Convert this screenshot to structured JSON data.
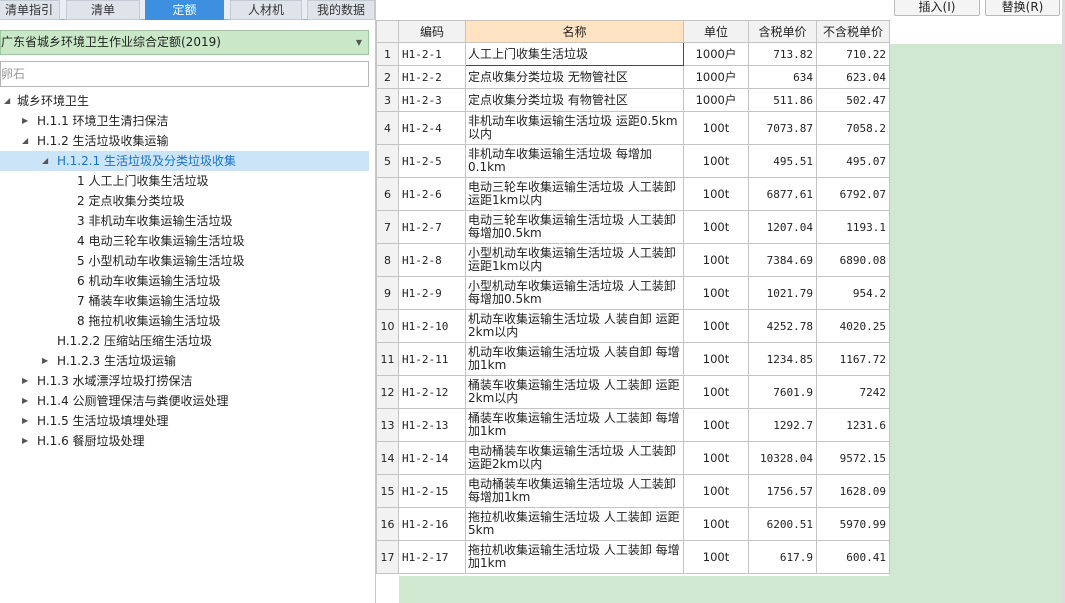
{
  "tabs": [
    {
      "label": "清单指引",
      "active": false
    },
    {
      "label": "清单",
      "active": false
    },
    {
      "label": "定额",
      "active": true
    },
    {
      "label": "人材机",
      "active": false
    },
    {
      "label": "我的数据",
      "active": false
    }
  ],
  "toolbar": {
    "insert_label": "插入(I)",
    "replace_label": "替换(R)"
  },
  "library_select": {
    "value": "广东省城乡环境卫生作业综合定额(2019)"
  },
  "search": {
    "value": "卵石"
  },
  "tree": [
    {
      "label": "城乡环境卫生",
      "level": 0,
      "toggle": "expanded",
      "selected": false
    },
    {
      "label": "H.1.1 环境卫生清扫保洁",
      "level": 1,
      "toggle": "collapsed",
      "selected": false
    },
    {
      "label": "H.1.2 生活垃圾收集运输",
      "level": 1,
      "toggle": "expanded",
      "selected": false
    },
    {
      "label": "H.1.2.1 生活垃圾及分类垃圾收集",
      "level": 2,
      "toggle": "expanded",
      "selected": true
    },
    {
      "label": "1 人工上门收集生活垃圾",
      "level": 3,
      "toggle": "none",
      "selected": false
    },
    {
      "label": "2 定点收集分类垃圾",
      "level": 3,
      "toggle": "none",
      "selected": false
    },
    {
      "label": "3 非机动车收集运输生活垃圾",
      "level": 3,
      "toggle": "none",
      "selected": false
    },
    {
      "label": "4 电动三轮车收集运输生活垃圾",
      "level": 3,
      "toggle": "none",
      "selected": false
    },
    {
      "label": "5 小型机动车收集运输生活垃圾",
      "level": 3,
      "toggle": "none",
      "selected": false
    },
    {
      "label": "6 机动车收集运输生活垃圾",
      "level": 3,
      "toggle": "none",
      "selected": false
    },
    {
      "label": "7 桶装车收集运输生活垃圾",
      "level": 3,
      "toggle": "none",
      "selected": false
    },
    {
      "label": "8 拖拉机收集运输生活垃圾",
      "level": 3,
      "toggle": "none",
      "selected": false
    },
    {
      "label": "H.1.2.2 压缩站压缩生活垃圾",
      "level": 2,
      "toggle": "none",
      "selected": false
    },
    {
      "label": "H.1.2.3 生活垃圾运输",
      "level": 2,
      "toggle": "collapsed",
      "selected": false
    },
    {
      "label": "H.1.3 水域漂浮垃圾打捞保洁",
      "level": 1,
      "toggle": "collapsed",
      "selected": false
    },
    {
      "label": "H.1.4 公厕管理保洁与粪便收运处理",
      "level": 1,
      "toggle": "collapsed",
      "selected": false
    },
    {
      "label": "H.1.5 生活垃圾填埋处理",
      "level": 1,
      "toggle": "collapsed",
      "selected": false
    },
    {
      "label": "H.1.6 餐厨垃圾处理",
      "level": 1,
      "toggle": "collapsed",
      "selected": false
    }
  ],
  "grid": {
    "columns": [
      "",
      "编码",
      "名称",
      "单位",
      "含税单价",
      "不含税单价"
    ],
    "rows": [
      {
        "no": "1",
        "code": "H1-2-1",
        "name": "人工上门收集生活垃圾",
        "unit": "1000户",
        "price_tax": "713.82",
        "price_notax": "710.22"
      },
      {
        "no": "2",
        "code": "H1-2-2",
        "name": "定点收集分类垃圾 无物管社区",
        "unit": "1000户",
        "price_tax": "634",
        "price_notax": "623.04"
      },
      {
        "no": "3",
        "code": "H1-2-3",
        "name": "定点收集分类垃圾 有物管社区",
        "unit": "1000户",
        "price_tax": "511.86",
        "price_notax": "502.47"
      },
      {
        "no": "4",
        "code": "H1-2-4",
        "name": "非机动车收集运输生活垃圾 运距0.5km以内",
        "unit": "100t",
        "price_tax": "7073.87",
        "price_notax": "7058.2"
      },
      {
        "no": "5",
        "code": "H1-2-5",
        "name": "非机动车收集运输生活垃圾 每增加0.1km",
        "unit": "100t",
        "price_tax": "495.51",
        "price_notax": "495.07"
      },
      {
        "no": "6",
        "code": "H1-2-6",
        "name": "电动三轮车收集运输生活垃圾 人工装卸运距1km以内",
        "unit": "100t",
        "price_tax": "6877.61",
        "price_notax": "6792.07"
      },
      {
        "no": "7",
        "code": "H1-2-7",
        "name": "电动三轮车收集运输生活垃圾 人工装卸每增加0.5km",
        "unit": "100t",
        "price_tax": "1207.04",
        "price_notax": "1193.1"
      },
      {
        "no": "8",
        "code": "H1-2-8",
        "name": "小型机动车收集运输生活垃圾 人工装卸运距1km以内",
        "unit": "100t",
        "price_tax": "7384.69",
        "price_notax": "6890.08"
      },
      {
        "no": "9",
        "code": "H1-2-9",
        "name": "小型机动车收集运输生活垃圾 人工装卸每增加0.5km",
        "unit": "100t",
        "price_tax": "1021.79",
        "price_notax": "954.2"
      },
      {
        "no": "10",
        "code": "H1-2-10",
        "name": "机动车收集运输生活垃圾 人装自卸 运距2km以内",
        "unit": "100t",
        "price_tax": "4252.78",
        "price_notax": "4020.25"
      },
      {
        "no": "11",
        "code": "H1-2-11",
        "name": "机动车收集运输生活垃圾 人装自卸 每增加1km",
        "unit": "100t",
        "price_tax": "1234.85",
        "price_notax": "1167.72"
      },
      {
        "no": "12",
        "code": "H1-2-12",
        "name": "桶装车收集运输生活垃圾 人工装卸 运距2km以内",
        "unit": "100t",
        "price_tax": "7601.9",
        "price_notax": "7242"
      },
      {
        "no": "13",
        "code": "H1-2-13",
        "name": "桶装车收集运输生活垃圾 人工装卸 每增加1km",
        "unit": "100t",
        "price_tax": "1292.7",
        "price_notax": "1231.6"
      },
      {
        "no": "14",
        "code": "H1-2-14",
        "name": "电动桶装车收集运输生活垃圾 人工装卸运距2km以内",
        "unit": "100t",
        "price_tax": "10328.04",
        "price_notax": "9572.15"
      },
      {
        "no": "15",
        "code": "H1-2-15",
        "name": "电动桶装车收集运输生活垃圾 人工装卸每增加1km",
        "unit": "100t",
        "price_tax": "1756.57",
        "price_notax": "1628.09"
      },
      {
        "no": "16",
        "code": "H1-2-16",
        "name": "拖拉机收集运输生活垃圾 人工装卸 运距5km",
        "unit": "100t",
        "price_tax": "6200.51",
        "price_notax": "5970.99"
      },
      {
        "no": "17",
        "code": "H1-2-17",
        "name": "拖拉机收集运输生活垃圾 人工装卸 每增加1km",
        "unit": "100t",
        "price_tax": "617.9",
        "price_notax": "600.41"
      }
    ]
  }
}
